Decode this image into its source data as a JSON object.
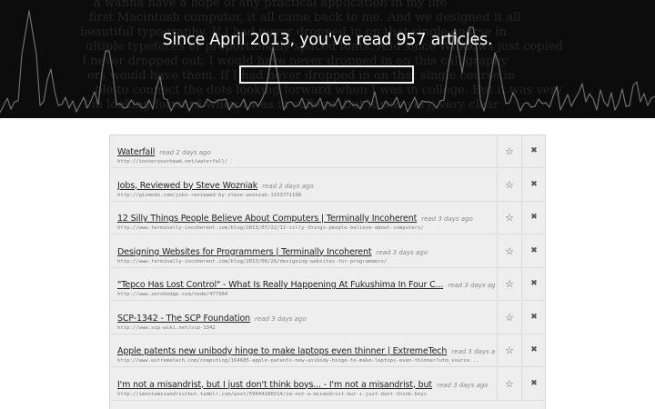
{
  "header": {
    "headline": "Since April 2013, you've read 957 articles.",
    "search": {
      "value": "",
      "placeholder": ""
    },
    "background_text": [
      "a wanna have a hope of any practical application in my life",
      "first Macintosh computer, it all came back to me. And we designed it all",
      "beautiful typography. If I had never dropped in on that single course in",
      "ultiple typefaces or proportionally spaced fonts. And since Windows just copied",
      "I never dropped out, I would have never dropped in on this calligraphy",
      "ers would have them. If I had never dropped in on that single course in",
      "ble to connect the dots looking forward when I was in college. But it was very",
      "I'm looking forward when I was in college. But it was very, very clear"
    ]
  },
  "icons": {
    "star": "star-icon",
    "remove": "remove-icon"
  },
  "articles": [
    {
      "title": "Waterfall",
      "age": "read 2 days ago",
      "url": "http://inoveryourhead.net/waterfall/"
    },
    {
      "title": "Jobs, Reviewed by Steve Wozniak",
      "age": "read 2 days ago",
      "url": "http://gizmodo.com/jobs-reviewed-by-steve-wozniak-1153771108"
    },
    {
      "title": "12 Silly Things People Believe About Computers | Terminally Incoherent",
      "age": "read 3 days ago",
      "url": "http://www.terminally-incoherent.com/blog/2013/07/22/12-silly-things-people-believe-about-computers/"
    },
    {
      "title": "Designing Websites for Programmers | Terminally Incoherent",
      "age": "read 3 days ago",
      "url": "http://www.terminally-incoherent.com/blog/2013/08/26/designing-websites-for-programmers/"
    },
    {
      "title": "\"Tepco Has Lost Control\" - What Is Really Happening At Fukushima In Four C...",
      "age": "read 3 days ago",
      "url": "http://www.zerohedge.com/node/477984"
    },
    {
      "title": "SCP-1342 - The SCP Foundation",
      "age": "read 3 days ago",
      "url": "http://www.scp-wiki.net/scp-1342"
    },
    {
      "title": "Apple patents new unibody hinge to make laptops even thinner | ExtremeTech",
      "age": "read 3 days ago",
      "url": "http://www.extremetech.com/computing/164685-apple-patents-new-unibody-hinge-to-make-laptops-even-thinner?utm_source..."
    },
    {
      "title": "I'm not a misandrist, but I just don't think boys... - I'm not a misandrist, but",
      "age": "read 3 days ago",
      "url": "http://imnotamisandristbut.tumblr.com/post/59044180214/im-not-a-misandrist-but-i-just-dont-think-boys"
    }
  ]
}
